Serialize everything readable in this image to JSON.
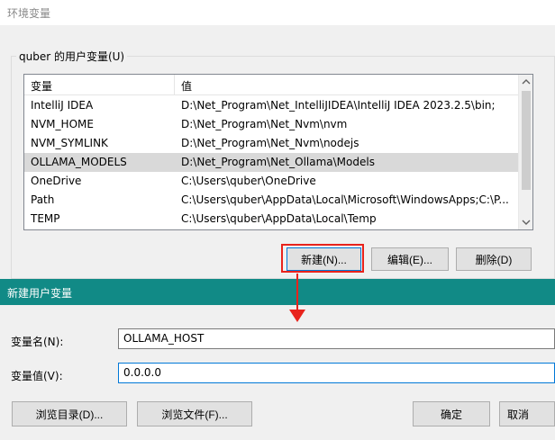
{
  "env_window": {
    "title": "环境变量",
    "group_label": "quber 的用户变量(U)",
    "columns": {
      "name": "变量",
      "value": "值"
    },
    "rows": [
      {
        "name": "IntelliJ IDEA",
        "value": "D:\\Net_Program\\Net_IntelliJIDEA\\IntelliJ IDEA 2023.2.5\\bin;"
      },
      {
        "name": "NVM_HOME",
        "value": "D:\\Net_Program\\Net_Nvm\\nvm"
      },
      {
        "name": "NVM_SYMLINK",
        "value": "D:\\Net_Program\\Net_Nvm\\nodejs"
      },
      {
        "name": "OLLAMA_MODELS",
        "value": "D:\\Net_Program\\Net_Ollama\\Models"
      },
      {
        "name": "OneDrive",
        "value": "C:\\Users\\quber\\OneDrive"
      },
      {
        "name": "Path",
        "value": "C:\\Users\\quber\\AppData\\Local\\Microsoft\\WindowsApps;C:\\P..."
      },
      {
        "name": "TEMP",
        "value": "C:\\Users\\quber\\AppData\\Local\\Temp"
      }
    ],
    "selected_row": 3,
    "buttons": {
      "new": "新建(N)...",
      "edit": "编辑(E)...",
      "delete": "删除(D)"
    }
  },
  "new_var_dialog": {
    "title": "新建用户变量",
    "name_label": "变量名(N):",
    "name_value": "OLLAMA_HOST",
    "value_label": "变量值(V):",
    "value_value": "0.0.0.0",
    "buttons": {
      "browse_dir": "浏览目录(D)...",
      "browse_file": "浏览文件(F)...",
      "ok": "确定",
      "cancel": "取消"
    }
  },
  "icons": {
    "scroll_up": "chevron-up-icon",
    "scroll_down": "chevron-down-icon",
    "annotation_arrow": "arrow-down-icon"
  },
  "colors": {
    "dialog_title_bg": "#118a86",
    "highlight_red": "#e8231c",
    "focus_blue": "#0078d7"
  }
}
